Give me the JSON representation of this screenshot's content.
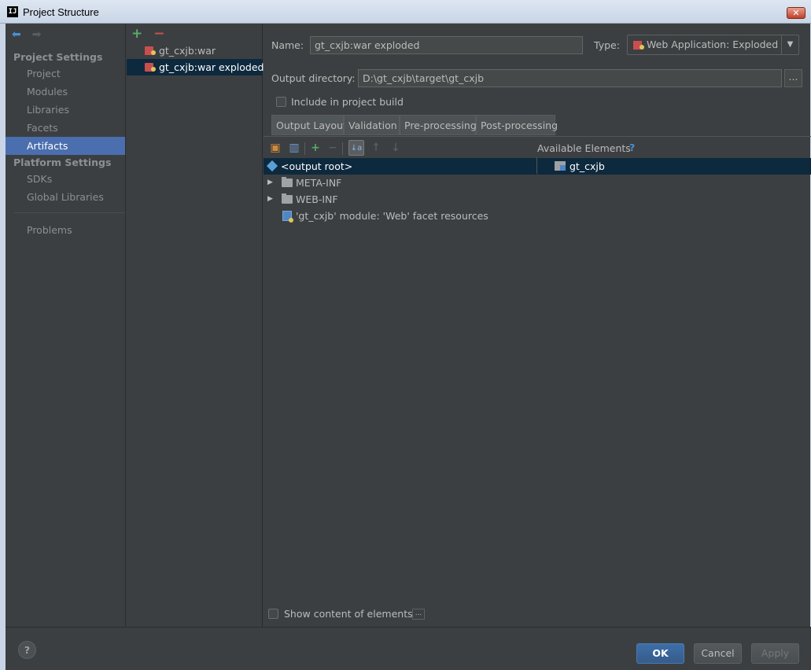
{
  "window": {
    "title": "Project Structure",
    "app_icon": "IJ",
    "close_glyph": "✕"
  },
  "sidebar": {
    "nav_back": "⬅",
    "nav_forward": "➡",
    "project_settings_header": "Project Settings",
    "items": [
      {
        "label": "Project"
      },
      {
        "label": "Modules"
      },
      {
        "label": "Libraries"
      },
      {
        "label": "Facets"
      },
      {
        "label": "Artifacts"
      }
    ],
    "platform_settings_header": "Platform Settings",
    "platform_items": [
      {
        "label": "SDKs"
      },
      {
        "label": "Global Libraries"
      }
    ],
    "problems_label": "Problems"
  },
  "artifacts": {
    "add_glyph": "+",
    "remove_glyph": "−",
    "items": [
      {
        "label": "gt_cxjb:war"
      },
      {
        "label": "gt_cxjb:war exploded"
      }
    ]
  },
  "main": {
    "name_label": "Name:",
    "name_value": "gt_cxjb:war exploded",
    "type_label": "Type:",
    "type_value": "Web Application: Exploded",
    "output_dir_label": "Output directory:",
    "output_dir_value": "D:\\gt_cxjb\\target\\gt_cxjb",
    "browse_label": "...",
    "include_build_label": "Include in project build",
    "tabs": [
      {
        "label": "Output Layout"
      },
      {
        "label": "Validation"
      },
      {
        "label": "Pre-processing"
      },
      {
        "label": "Post-processing"
      }
    ],
    "available_elements_label": "Available Elements",
    "help_glyph": "?",
    "tree": [
      {
        "label": "<output root>"
      },
      {
        "label": "META-INF"
      },
      {
        "label": "WEB-INF"
      },
      {
        "label": "'gt_cxjb' module: 'Web' facet resources"
      }
    ],
    "available_tree": [
      {
        "label": "gt_cxjb"
      }
    ],
    "show_content_label": "Show content of elements",
    "show_content_btn": "..."
  },
  "buttons": {
    "help": "?",
    "ok": "OK",
    "cancel": "Cancel",
    "apply": "Apply"
  },
  "colors": {
    "background": "#3c3f41",
    "selection": "#4b6eaf",
    "tree_selection": "#0d293e",
    "accent_blue": "#4a8fd6",
    "add_green": "#59a869",
    "remove_red": "#c75450"
  }
}
